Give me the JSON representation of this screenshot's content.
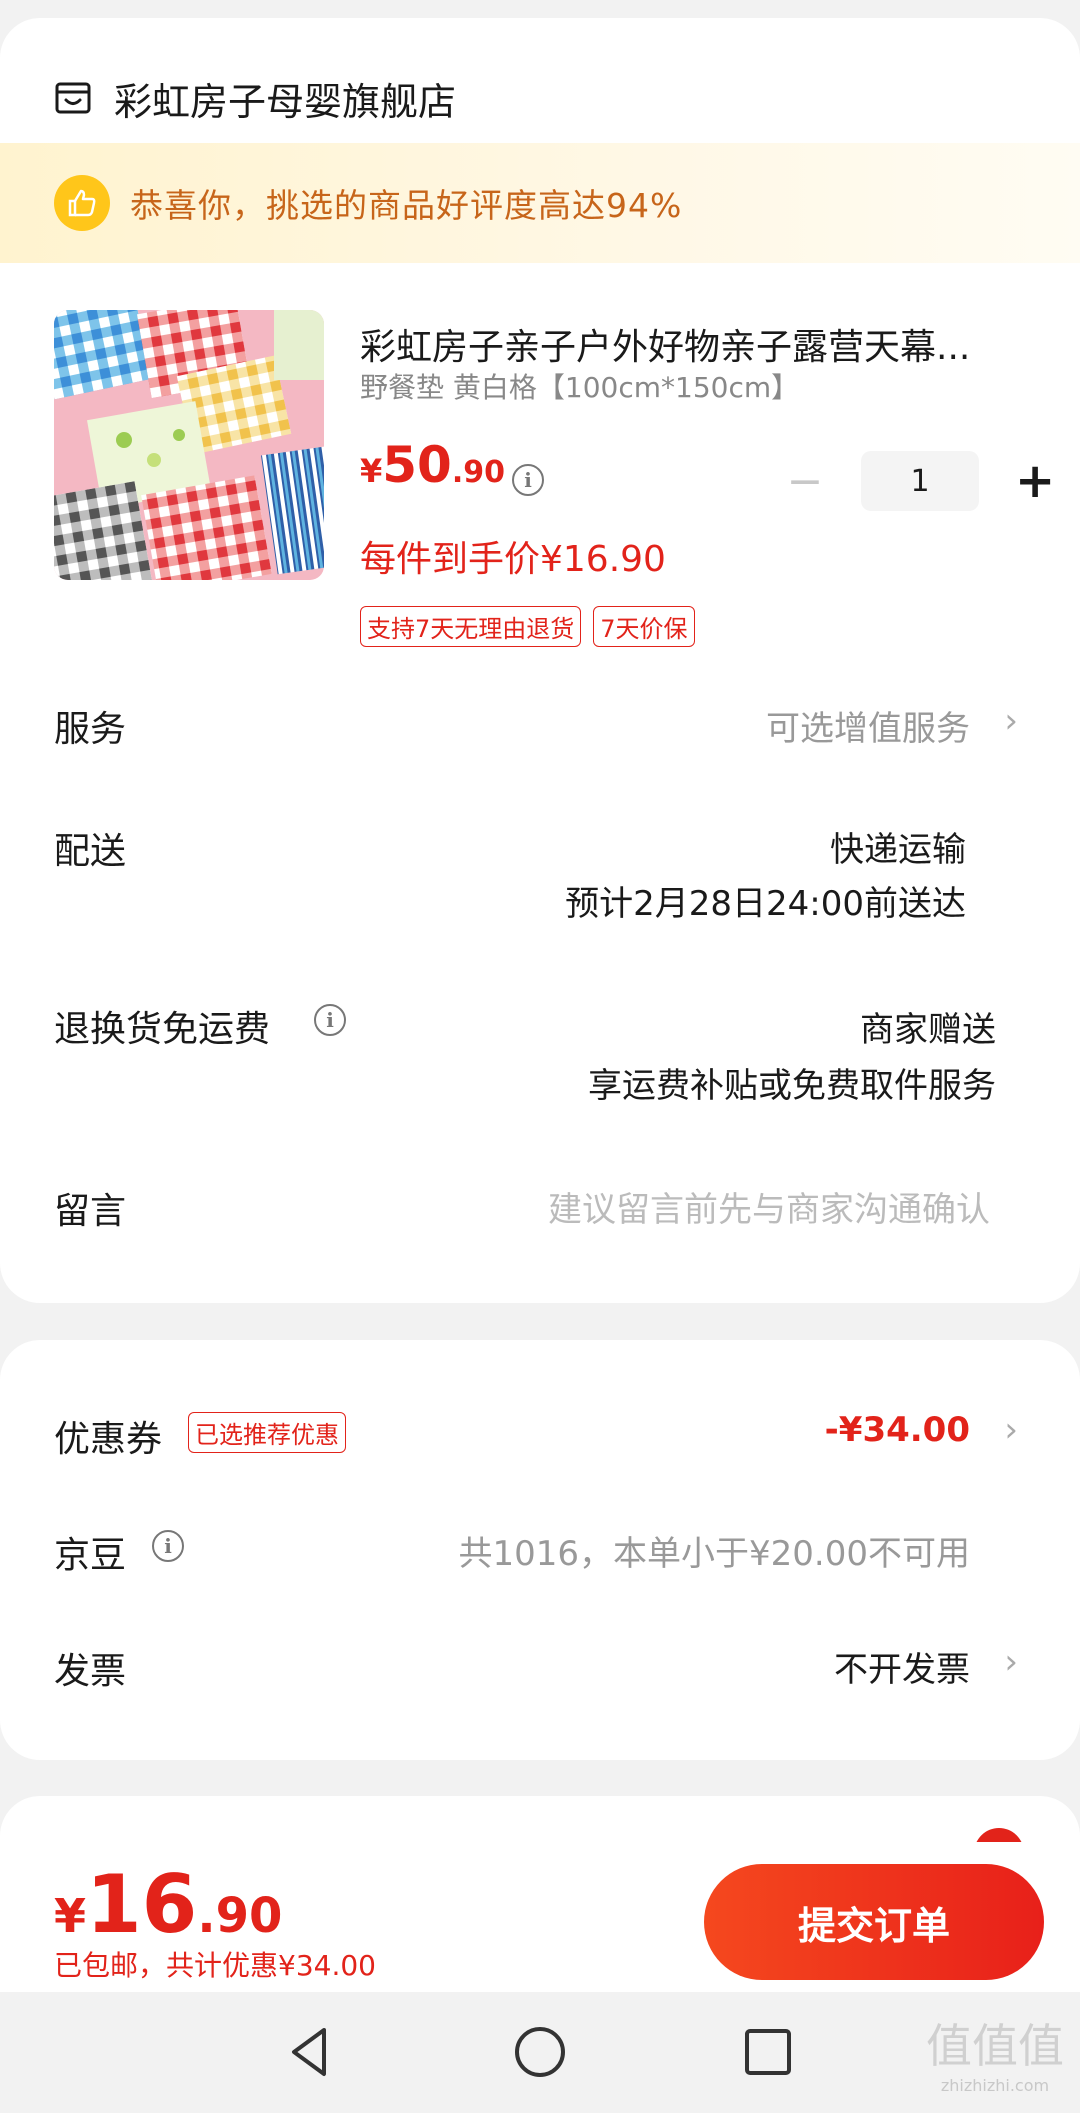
{
  "store": {
    "name": "彩虹房子母婴旗舰店",
    "icon": "store-icon"
  },
  "banner": {
    "text": "恭喜你，挑选的商品好评度高达94%",
    "icon": "thumbs-up-icon"
  },
  "product": {
    "title": "彩虹房子亲子户外好物亲子露营天幕...",
    "spec": "野餐垫 黄白格【100cm*150cm】",
    "price_symbol": "¥",
    "price_int": "50",
    "price_dec": ".90",
    "quantity": "1",
    "minus": "−",
    "plus": "+",
    "unit_price": "每件到手价¥16.90",
    "tags": [
      "支持7天无理由退货",
      "7天价保"
    ]
  },
  "rows": {
    "service_label": "服务",
    "service_value": "可选增值服务",
    "delivery_label": "配送",
    "delivery_value_1": "快递运输",
    "delivery_value_2": "预计2月28日24:00前送达",
    "return_label": "退换货免运费",
    "return_value_1": "商家赠送",
    "return_value_2": "享运费补贴或免费取件服务",
    "message_label": "留言",
    "message_placeholder": "建议留言前先与商家沟通确认"
  },
  "discounts": {
    "coupon_label": "优惠券",
    "coupon_tag": "已选推荐优惠",
    "coupon_value": "-¥34.00",
    "beans_label": "京豆",
    "beans_value": "共1016，本单小于¥20.00不可用",
    "invoice_label": "发票",
    "invoice_value": "不开发票"
  },
  "footer": {
    "total_symbol": "¥",
    "total_int": "16",
    "total_dec": ".90",
    "free_shipping": "已包邮，",
    "discount_text": "共计优惠¥34.00",
    "submit": "提交订单"
  },
  "chevron": "›",
  "info": "i",
  "watermark": {
    "glyphs": "值值值",
    "url": "zhizhizhi.com"
  },
  "colors": {
    "accent": "#e2231a",
    "banner_text": "#c7651a",
    "banner_bg": "#fff3cf",
    "badge": "#ffc61a"
  }
}
